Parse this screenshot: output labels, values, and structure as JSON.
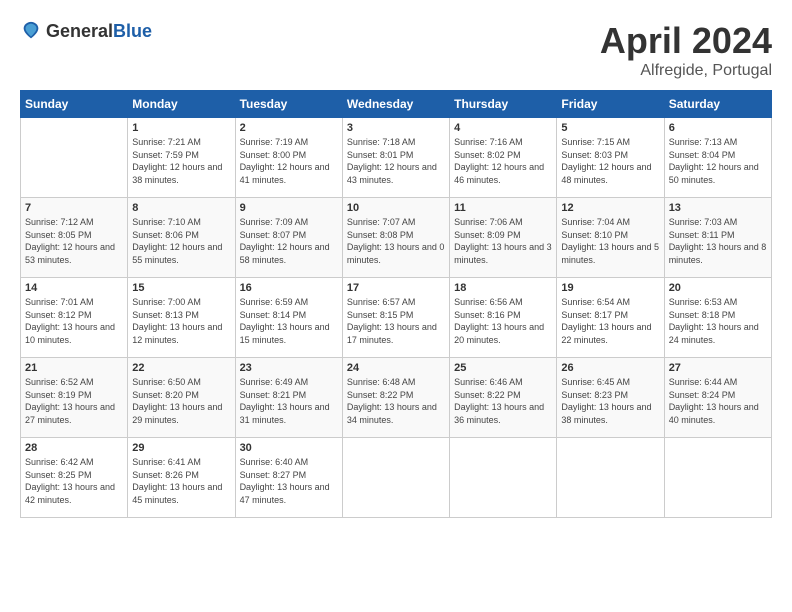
{
  "header": {
    "logo_general": "General",
    "logo_blue": "Blue",
    "month_title": "April 2024",
    "location": "Alfregide, Portugal"
  },
  "weekdays": [
    "Sunday",
    "Monday",
    "Tuesday",
    "Wednesday",
    "Thursday",
    "Friday",
    "Saturday"
  ],
  "weeks": [
    [
      {
        "day": "",
        "sunrise": "",
        "sunset": "",
        "daylight": ""
      },
      {
        "day": "1",
        "sunrise": "Sunrise: 7:21 AM",
        "sunset": "Sunset: 7:59 PM",
        "daylight": "Daylight: 12 hours and 38 minutes."
      },
      {
        "day": "2",
        "sunrise": "Sunrise: 7:19 AM",
        "sunset": "Sunset: 8:00 PM",
        "daylight": "Daylight: 12 hours and 41 minutes."
      },
      {
        "day": "3",
        "sunrise": "Sunrise: 7:18 AM",
        "sunset": "Sunset: 8:01 PM",
        "daylight": "Daylight: 12 hours and 43 minutes."
      },
      {
        "day": "4",
        "sunrise": "Sunrise: 7:16 AM",
        "sunset": "Sunset: 8:02 PM",
        "daylight": "Daylight: 12 hours and 46 minutes."
      },
      {
        "day": "5",
        "sunrise": "Sunrise: 7:15 AM",
        "sunset": "Sunset: 8:03 PM",
        "daylight": "Daylight: 12 hours and 48 minutes."
      },
      {
        "day": "6",
        "sunrise": "Sunrise: 7:13 AM",
        "sunset": "Sunset: 8:04 PM",
        "daylight": "Daylight: 12 hours and 50 minutes."
      }
    ],
    [
      {
        "day": "7",
        "sunrise": "Sunrise: 7:12 AM",
        "sunset": "Sunset: 8:05 PM",
        "daylight": "Daylight: 12 hours and 53 minutes."
      },
      {
        "day": "8",
        "sunrise": "Sunrise: 7:10 AM",
        "sunset": "Sunset: 8:06 PM",
        "daylight": "Daylight: 12 hours and 55 minutes."
      },
      {
        "day": "9",
        "sunrise": "Sunrise: 7:09 AM",
        "sunset": "Sunset: 8:07 PM",
        "daylight": "Daylight: 12 hours and 58 minutes."
      },
      {
        "day": "10",
        "sunrise": "Sunrise: 7:07 AM",
        "sunset": "Sunset: 8:08 PM",
        "daylight": "Daylight: 13 hours and 0 minutes."
      },
      {
        "day": "11",
        "sunrise": "Sunrise: 7:06 AM",
        "sunset": "Sunset: 8:09 PM",
        "daylight": "Daylight: 13 hours and 3 minutes."
      },
      {
        "day": "12",
        "sunrise": "Sunrise: 7:04 AM",
        "sunset": "Sunset: 8:10 PM",
        "daylight": "Daylight: 13 hours and 5 minutes."
      },
      {
        "day": "13",
        "sunrise": "Sunrise: 7:03 AM",
        "sunset": "Sunset: 8:11 PM",
        "daylight": "Daylight: 13 hours and 8 minutes."
      }
    ],
    [
      {
        "day": "14",
        "sunrise": "Sunrise: 7:01 AM",
        "sunset": "Sunset: 8:12 PM",
        "daylight": "Daylight: 13 hours and 10 minutes."
      },
      {
        "day": "15",
        "sunrise": "Sunrise: 7:00 AM",
        "sunset": "Sunset: 8:13 PM",
        "daylight": "Daylight: 13 hours and 12 minutes."
      },
      {
        "day": "16",
        "sunrise": "Sunrise: 6:59 AM",
        "sunset": "Sunset: 8:14 PM",
        "daylight": "Daylight: 13 hours and 15 minutes."
      },
      {
        "day": "17",
        "sunrise": "Sunrise: 6:57 AM",
        "sunset": "Sunset: 8:15 PM",
        "daylight": "Daylight: 13 hours and 17 minutes."
      },
      {
        "day": "18",
        "sunrise": "Sunrise: 6:56 AM",
        "sunset": "Sunset: 8:16 PM",
        "daylight": "Daylight: 13 hours and 20 minutes."
      },
      {
        "day": "19",
        "sunrise": "Sunrise: 6:54 AM",
        "sunset": "Sunset: 8:17 PM",
        "daylight": "Daylight: 13 hours and 22 minutes."
      },
      {
        "day": "20",
        "sunrise": "Sunrise: 6:53 AM",
        "sunset": "Sunset: 8:18 PM",
        "daylight": "Daylight: 13 hours and 24 minutes."
      }
    ],
    [
      {
        "day": "21",
        "sunrise": "Sunrise: 6:52 AM",
        "sunset": "Sunset: 8:19 PM",
        "daylight": "Daylight: 13 hours and 27 minutes."
      },
      {
        "day": "22",
        "sunrise": "Sunrise: 6:50 AM",
        "sunset": "Sunset: 8:20 PM",
        "daylight": "Daylight: 13 hours and 29 minutes."
      },
      {
        "day": "23",
        "sunrise": "Sunrise: 6:49 AM",
        "sunset": "Sunset: 8:21 PM",
        "daylight": "Daylight: 13 hours and 31 minutes."
      },
      {
        "day": "24",
        "sunrise": "Sunrise: 6:48 AM",
        "sunset": "Sunset: 8:22 PM",
        "daylight": "Daylight: 13 hours and 34 minutes."
      },
      {
        "day": "25",
        "sunrise": "Sunrise: 6:46 AM",
        "sunset": "Sunset: 8:22 PM",
        "daylight": "Daylight: 13 hours and 36 minutes."
      },
      {
        "day": "26",
        "sunrise": "Sunrise: 6:45 AM",
        "sunset": "Sunset: 8:23 PM",
        "daylight": "Daylight: 13 hours and 38 minutes."
      },
      {
        "day": "27",
        "sunrise": "Sunrise: 6:44 AM",
        "sunset": "Sunset: 8:24 PM",
        "daylight": "Daylight: 13 hours and 40 minutes."
      }
    ],
    [
      {
        "day": "28",
        "sunrise": "Sunrise: 6:42 AM",
        "sunset": "Sunset: 8:25 PM",
        "daylight": "Daylight: 13 hours and 42 minutes."
      },
      {
        "day": "29",
        "sunrise": "Sunrise: 6:41 AM",
        "sunset": "Sunset: 8:26 PM",
        "daylight": "Daylight: 13 hours and 45 minutes."
      },
      {
        "day": "30",
        "sunrise": "Sunrise: 6:40 AM",
        "sunset": "Sunset: 8:27 PM",
        "daylight": "Daylight: 13 hours and 47 minutes."
      },
      {
        "day": "",
        "sunrise": "",
        "sunset": "",
        "daylight": ""
      },
      {
        "day": "",
        "sunrise": "",
        "sunset": "",
        "daylight": ""
      },
      {
        "day": "",
        "sunrise": "",
        "sunset": "",
        "daylight": ""
      },
      {
        "day": "",
        "sunrise": "",
        "sunset": "",
        "daylight": ""
      }
    ]
  ]
}
